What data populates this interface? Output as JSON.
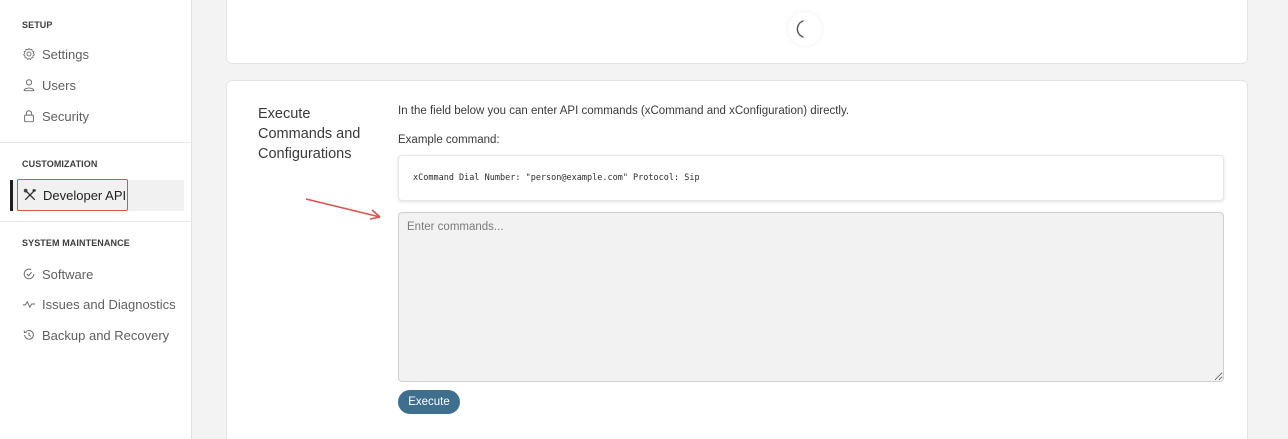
{
  "sidebar": {
    "setup": {
      "title": "SETUP",
      "items": [
        {
          "label": "Settings",
          "icon": "gear-icon"
        },
        {
          "label": "Users",
          "icon": "user-icon"
        },
        {
          "label": "Security",
          "icon": "lock-icon"
        }
      ]
    },
    "customization": {
      "title": "CUSTOMIZATION",
      "items": [
        {
          "label": "Developer API",
          "icon": "tools-icon",
          "active": true
        }
      ]
    },
    "maintenance": {
      "title": "SYSTEM MAINTENANCE",
      "items": [
        {
          "label": "Software",
          "icon": "software-icon"
        },
        {
          "label": "Issues and Diagnostics",
          "icon": "pulse-icon"
        },
        {
          "label": "Backup and Recovery",
          "icon": "history-icon"
        }
      ]
    }
  },
  "main": {
    "section_heading": "Execute Commands and Configurations",
    "intro": "In the field below you can enter API commands (xCommand and xConfiguration) directly.",
    "example_label": "Example command:",
    "example_code": "xCommand Dial Number: \"person@example.com\" Protocol: Sip",
    "commands_placeholder": "Enter commands...",
    "commands_value": "",
    "execute_label": "Execute"
  },
  "colors": {
    "accent": "#3f6f8f",
    "annotation": "#d9534f",
    "active_bar": "#1f1f1f"
  }
}
